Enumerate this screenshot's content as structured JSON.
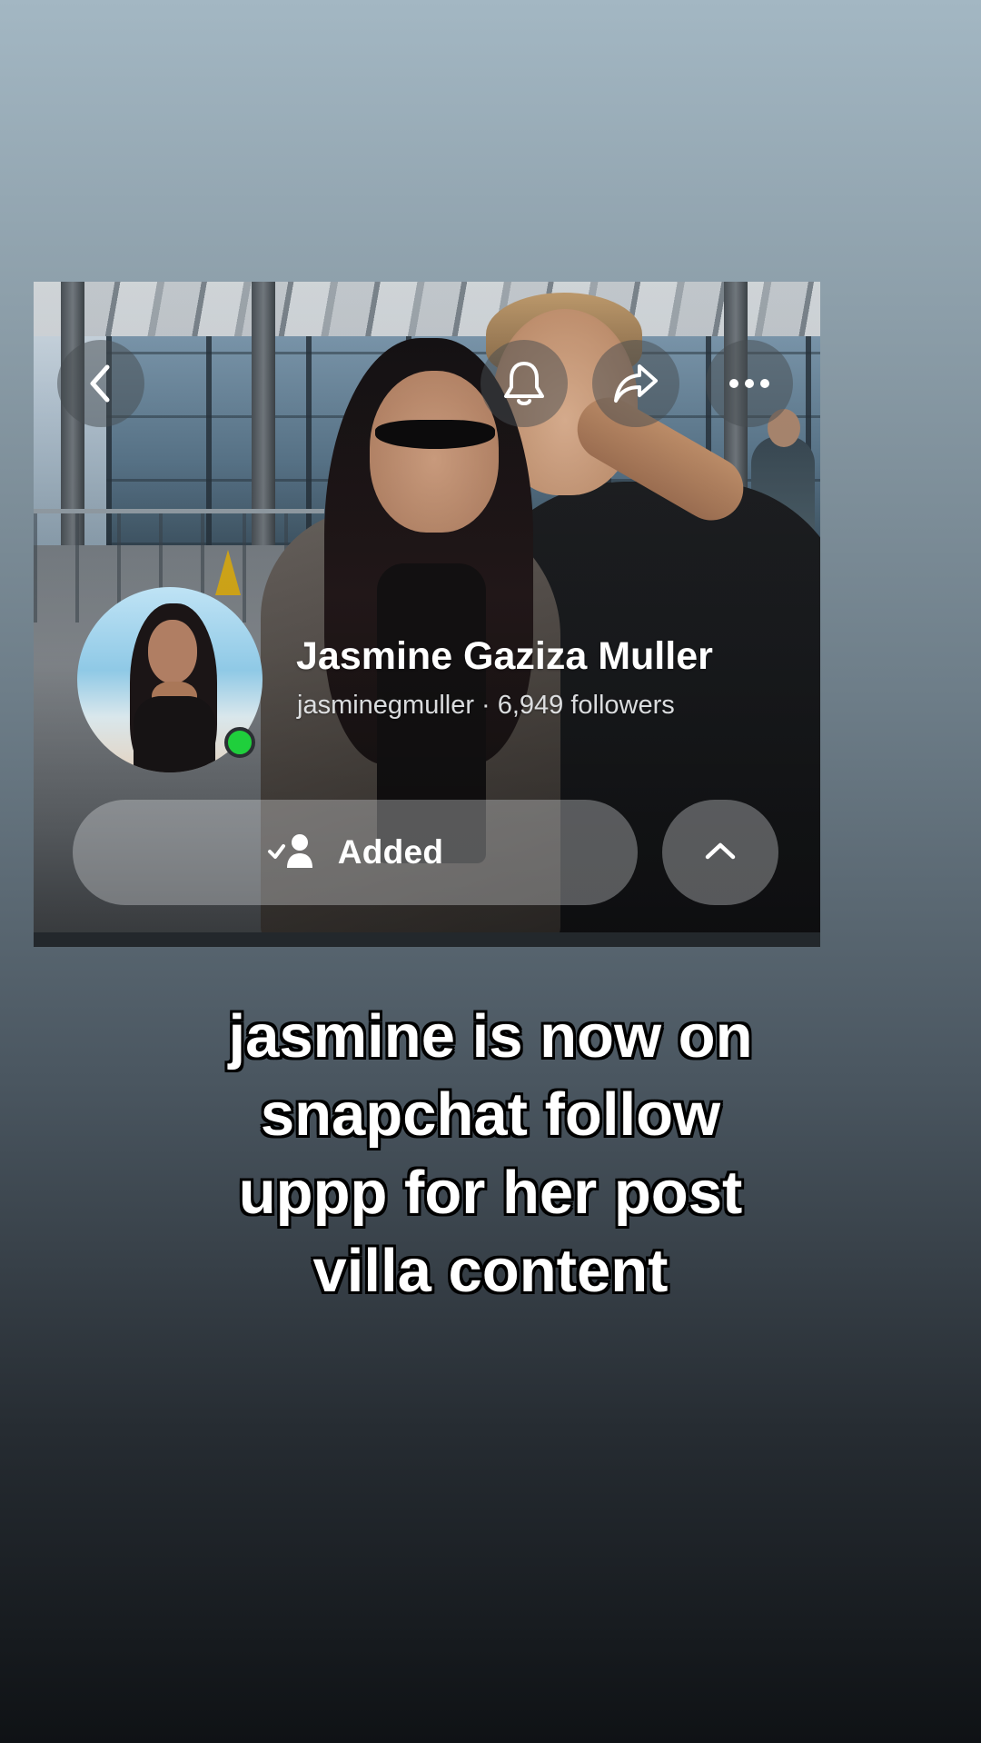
{
  "profile": {
    "display_name": "Jasmine Gaziza Muller",
    "username": "jasminegmuller",
    "separator": "·",
    "followers": "6,949 followers",
    "online_status_color": "#1fcf3c"
  },
  "actions": {
    "added_label": "Added"
  },
  "icons": {
    "back": "chevron-left-icon",
    "notifications": "bell-icon",
    "share": "share-arrow-icon",
    "more": "more-dots-icon",
    "added": "user-check-icon",
    "expand": "chevron-up-icon"
  },
  "caption": {
    "line1": "jasmine is now on",
    "line2": "snapchat follow",
    "line3": "uppp for her post",
    "line4": "villa content"
  },
  "colors": {
    "caption_text": "#ffffff",
    "caption_outline": "#000000"
  }
}
